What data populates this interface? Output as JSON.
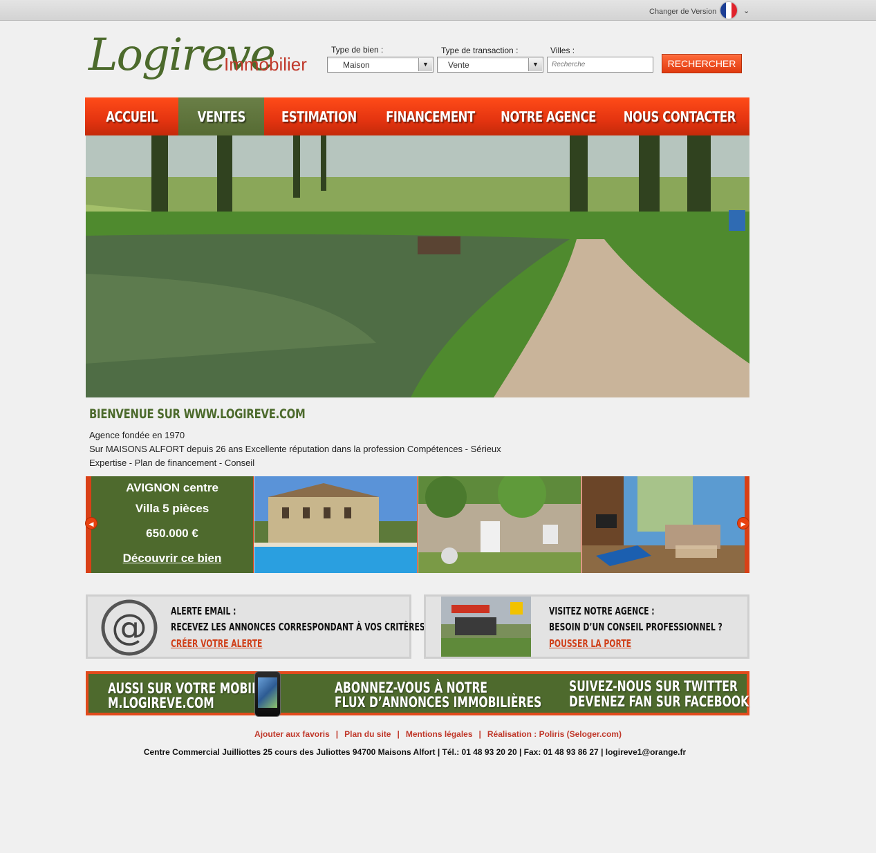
{
  "topbar": {
    "version_label": "Changer de Version",
    "flag_colors": [
      "#1d3f95",
      "#ffffff",
      "#e0222b"
    ]
  },
  "logo": {
    "main": "Logireve",
    "sub": "Immobilier"
  },
  "search": {
    "type_bien_label": "Type de bien :",
    "type_bien_value": "Maison",
    "type_transaction_label": "Type de transaction :",
    "type_transaction_value": "Vente",
    "villes_label": "Villes :",
    "villes_placeholder": "Recherche",
    "button_label": "RECHERCHER"
  },
  "nav": {
    "items": [
      "ACCUEIL",
      "VENTES",
      "ESTIMATION",
      "FINANCEMENT",
      "NOTRE AGENCE",
      "NOUS CONTACTER"
    ],
    "active_index": 1
  },
  "welcome": {
    "title": "BIENVENUE SUR WWW.LOGIREVE.COM",
    "lines": [
      "Agence fondée en 1970",
      "Sur MAISONS ALFORT depuis 26 ans Excellente réputation dans la profession Compétences - Sérieux",
      "Expertise - Plan de financement - Conseil"
    ]
  },
  "carousel": {
    "location": "AVIGNON centre",
    "property": "Villa 5 pièces",
    "price": "650.000 €",
    "cta": "Découvrir ce bien"
  },
  "info_boxes": [
    {
      "title": "ALERTE EMAIL :",
      "text": "RECEVEZ LES ANNONCES CORRESPONDANT À VOS CRITÈRES",
      "link": "CRÉER VOTRE ALERTE"
    },
    {
      "title": "VISITEZ NOTRE AGENCE :",
      "text": "BESOIN D’UN CONSEIL PROFESSIONNEL ?",
      "link": "POUSSER LA PORTE"
    }
  ],
  "banner": {
    "mobile_line1": "AUSSI SUR VOTRE  MOBILE",
    "mobile_line2": "M.LOGIREVE.COM",
    "rss_line1": "ABONNEZ-VOUS À NOTRE",
    "rss_line2": "FLUX D’ANNONCES IMMOBILIÈRES",
    "social_line1": "SUIVEZ-NOUS SUR TWITTER",
    "social_line2": "DEVENEZ FAN SUR FACEBOOK"
  },
  "footer": {
    "links": [
      "Ajouter aux favoris",
      "Plan du site",
      "Mentions légales",
      "Réalisation : Poliris (Seloger.com)"
    ],
    "address": "Centre Commercial Juilliottes 25 cours des Juliottes 94700 Maisons Alfort | Tél.: 01 48 93 20 20 | Fax: 01 48 93 86 27  |  logireve1@orange.fr"
  }
}
